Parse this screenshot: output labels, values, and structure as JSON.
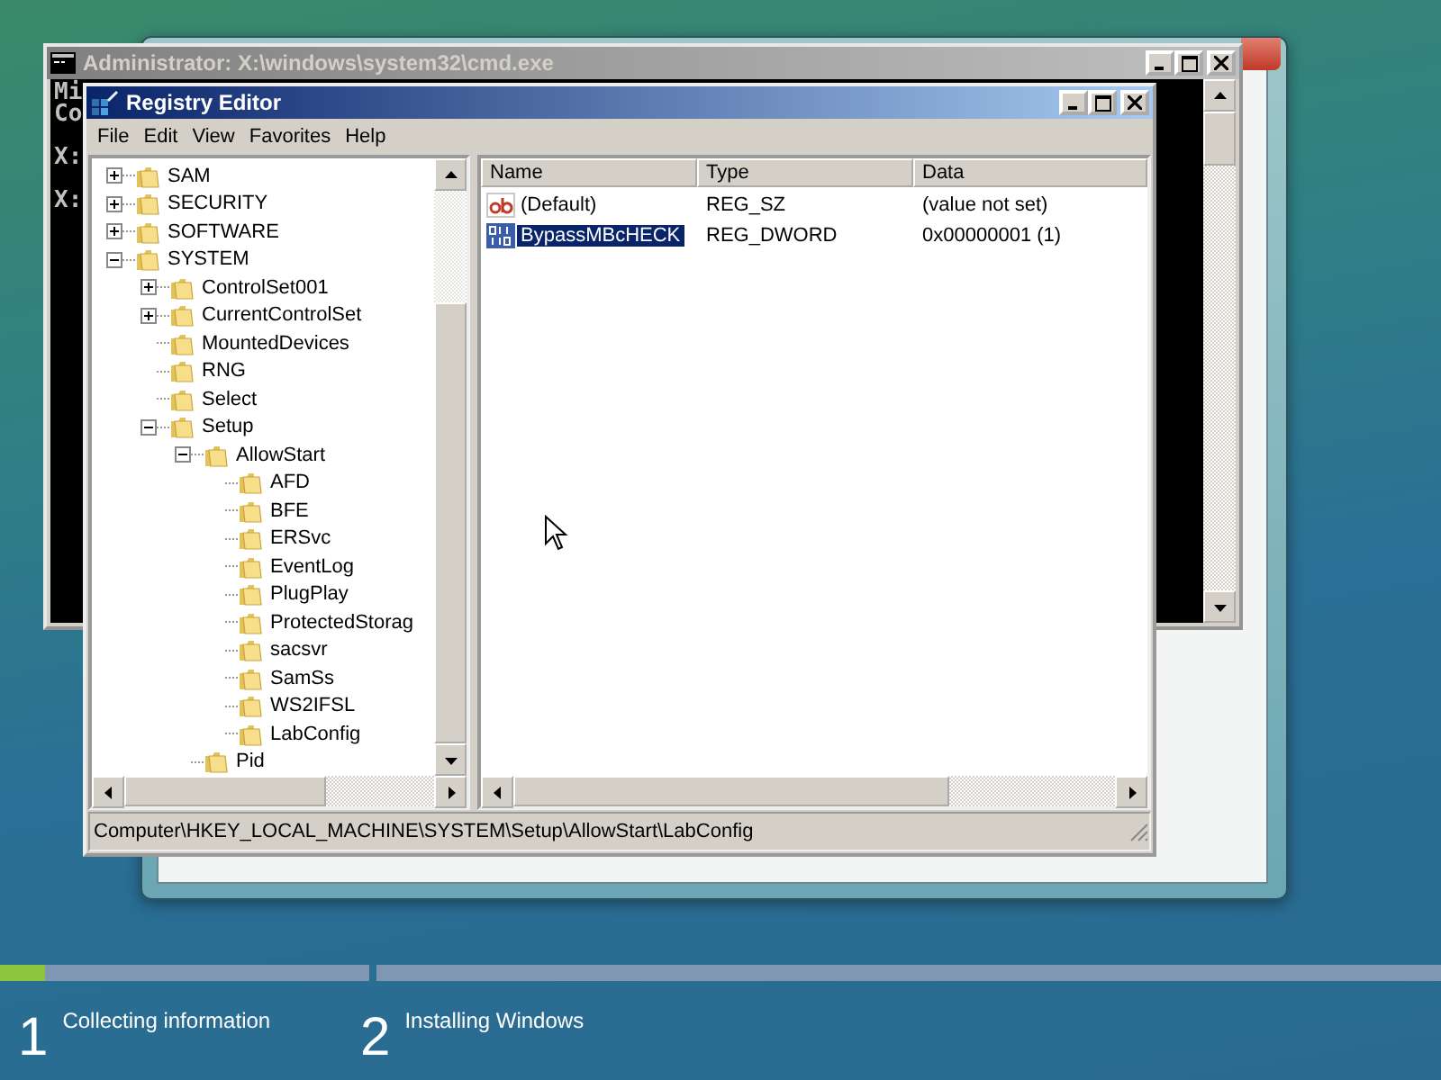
{
  "console_window": {
    "title": "Administrator: X:\\windows\\system32\\cmd.exe",
    "lines": [
      {
        "text": "Mi",
        "blank_before": false
      },
      {
        "text": "Co",
        "blank_before": false
      },
      {
        "text": "X:",
        "blank_before": true
      },
      {
        "text": "X:",
        "blank_before": true
      }
    ]
  },
  "registry_editor": {
    "title": "Registry Editor",
    "menu": [
      "File",
      "Edit",
      "View",
      "Favorites",
      "Help"
    ],
    "tree": [
      {
        "label": "SAM",
        "expanded": false
      },
      {
        "label": "SECURITY",
        "expanded": false
      },
      {
        "label": "SOFTWARE",
        "expanded": false
      },
      {
        "label": "SYSTEM",
        "expanded": true,
        "children": [
          {
            "label": "ControlSet001",
            "expanded": false
          },
          {
            "label": "CurrentControlSet",
            "expanded": false
          },
          {
            "label": "MountedDevices"
          },
          {
            "label": "RNG"
          },
          {
            "label": "Select"
          },
          {
            "label": "Setup",
            "expanded": true,
            "children": [
              {
                "label": "AllowStart",
                "expanded": true,
                "children": [
                  {
                    "label": "AFD"
                  },
                  {
                    "label": "BFE"
                  },
                  {
                    "label": "ERSvc"
                  },
                  {
                    "label": "EventLog"
                  },
                  {
                    "label": "PlugPlay"
                  },
                  {
                    "label": "ProtectedStorag"
                  },
                  {
                    "label": "sacsvr"
                  },
                  {
                    "label": "SamSs"
                  },
                  {
                    "label": "WS2IFSL"
                  },
                  {
                    "label": "LabConfig"
                  }
                ]
              },
              {
                "label": "Pid"
              }
            ]
          }
        ]
      }
    ],
    "columns": [
      "Name",
      "Type",
      "Data"
    ],
    "values": [
      {
        "kind": "string",
        "name": "(Default)",
        "type": "REG_SZ",
        "data": "(value not set)",
        "selected": false
      },
      {
        "kind": "binary",
        "name": "BypassMBcHECK",
        "type": "REG_DWORD",
        "data": "0x00000001 (1)",
        "selected": true
      }
    ],
    "status_bar": "Computer\\HKEY_LOCAL_MACHINE\\SYSTEM\\Setup\\AllowStart\\LabConfig"
  },
  "setup_progress": {
    "steps": [
      {
        "number": "1",
        "label": "Collecting information",
        "level": 0.12
      },
      {
        "number": "2",
        "label": "Installing Windows"
      }
    ]
  }
}
